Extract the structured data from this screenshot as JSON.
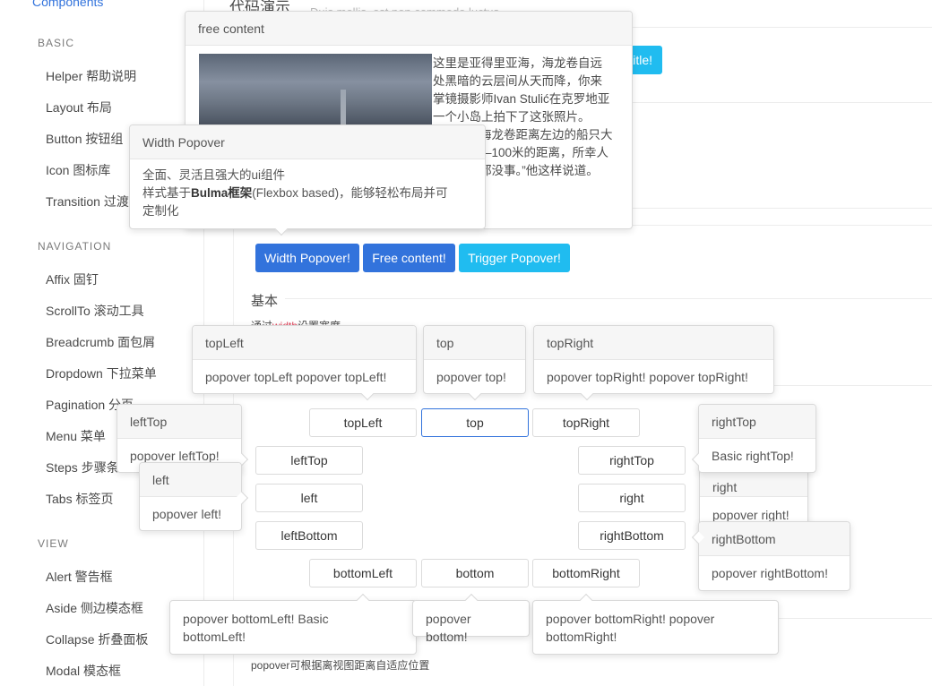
{
  "sidebar": {
    "top_link": "Components",
    "sections": [
      {
        "title": "BASIC"
      },
      {
        "title": "NAVIGATION"
      },
      {
        "title": "VIEW"
      }
    ],
    "basic_items": [
      "Helper 帮助说明",
      "Layout 布局",
      "Button 按钮组",
      "Icon 图标库",
      "Transition 过渡"
    ],
    "navigation_items": [
      "Affix 固钉",
      "ScrollTo 滚动工具",
      "Breadcrumb 面包屑",
      "Dropdown 下拉菜单",
      "Pagination 分页",
      "Menu 菜单",
      "Steps 步骤条",
      "Tabs 标签页"
    ],
    "view_items": [
      "Alert 警告框",
      "Aside 侧边模态框",
      "Collapse 折叠面板",
      "Modal 模态框"
    ]
  },
  "main": {
    "demo_title": "代码演示",
    "faded_text": "Duis mollis, est non commodo luctus",
    "title_button": "title!",
    "buttons_row1": {
      "width": "Width Popover!",
      "free": "Free content!",
      "trigger": "Trigger Popover!"
    },
    "section_basic": "基本",
    "basic_desc": {
      "prefix": "通过",
      "code": "width",
      "suffix": "设置宽度"
    },
    "placement_buttons": {
      "topLeft": "topLeft",
      "top": "top",
      "topRight": "topRight",
      "leftTop": "leftTop",
      "left": "left",
      "leftBottom": "leftBottom",
      "rightTop": "rightTop",
      "right": "right",
      "rightBottom": "rightBottom",
      "bottomLeft": "bottomLeft",
      "bottom": "bottom",
      "bottomRight": "bottomRight"
    },
    "footer_note": "popover可根据离视图距离自适应位置"
  },
  "popovers": {
    "free": {
      "title": "free content",
      "text": "这里是亚得里亚海，海龙卷自远处黑暗的云层间从天而降，你来掌镜摄影师Ivan Stulić在克罗地亚一个小岛上拍下了这张照片。“海龙卷距离左边的船只大约50—100米的距离，所幸人们都没事。”他这样说道。",
      "visible_text_lines": [
        "这里是亚得里亚海，海龙卷自远",
        "处黑暗的云层间从天而降，你来",
        "掌镜摄影师Ivan Stulić在克罗地亚",
        "一个小岛上拍下了这张照片。",
        "海龙卷距离左边的船只大",
        "—100米的距离，所幸人",
        "都没事。”他这样说道。"
      ]
    },
    "width": {
      "title": "Width Popover",
      "line1": "全面、灵活且强大的ui组件",
      "line2_prefix": "样式基于",
      "line2_bold": "Bulma框架",
      "line2_suffix": "(Flexbox based)，能够轻松布局并可",
      "line3": "定制化"
    },
    "topLeft": {
      "title": "topLeft",
      "body": "popover topLeft popover topLeft!"
    },
    "top": {
      "title": "top",
      "body": "popover top!"
    },
    "topRight": {
      "title": "topRight",
      "body": "popover topRight! popover topRight!"
    },
    "leftTop": {
      "title": "leftTop",
      "body": "popover leftTop!"
    },
    "left": {
      "title": "left",
      "body": "popover left!"
    },
    "rightTop": {
      "title": "rightTop",
      "body": "Basic rightTop!"
    },
    "right": {
      "title": "right",
      "body": "popover right!"
    },
    "rightBottom": {
      "title": "rightBottom",
      "body": "popover rightBottom!"
    },
    "bottomLeft": {
      "line1": "popover bottomLeft! Basic",
      "line2": "bottomLeft!"
    },
    "bottom": {
      "body": "popover bottom!"
    },
    "bottomRight": {
      "line1": "popover bottomRight! popover",
      "line2": "bottomRight!"
    }
  },
  "colors": {
    "primary": "#3273dc",
    "info": "#20bcf0",
    "link": "#3273dc",
    "code": "#e0435a"
  }
}
